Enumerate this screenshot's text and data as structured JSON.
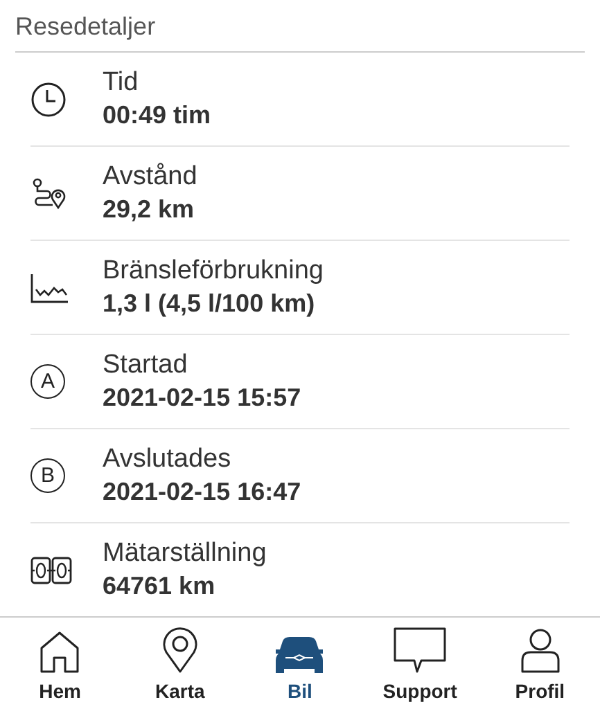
{
  "section": {
    "title": "Resedetaljer"
  },
  "details": [
    {
      "kind": "clock",
      "label": "Tid",
      "value": "00:49 tim"
    },
    {
      "kind": "route",
      "label": "Avstånd",
      "value": "29,2 km"
    },
    {
      "kind": "chart",
      "label": "Bränsleförbrukning",
      "value": "1,3 l (4,5 l/100 km)"
    },
    {
      "kind": "letter",
      "badge": "A",
      "label": "Startad",
      "value": "2021-02-15 15:57"
    },
    {
      "kind": "letter",
      "badge": "B",
      "label": "Avslutades",
      "value": "2021-02-15 16:47"
    },
    {
      "kind": "odometer",
      "label": "Mätarställning",
      "value": "64761 km"
    }
  ],
  "tab_bar": [
    {
      "kind": "home",
      "label": "Hem",
      "selected": false
    },
    {
      "kind": "pin",
      "label": "Karta",
      "selected": false
    },
    {
      "kind": "car",
      "label": "Bil",
      "selected": true
    },
    {
      "kind": "chat",
      "label": "Support",
      "selected": false
    },
    {
      "kind": "person",
      "label": "Profil",
      "selected": false
    }
  ]
}
